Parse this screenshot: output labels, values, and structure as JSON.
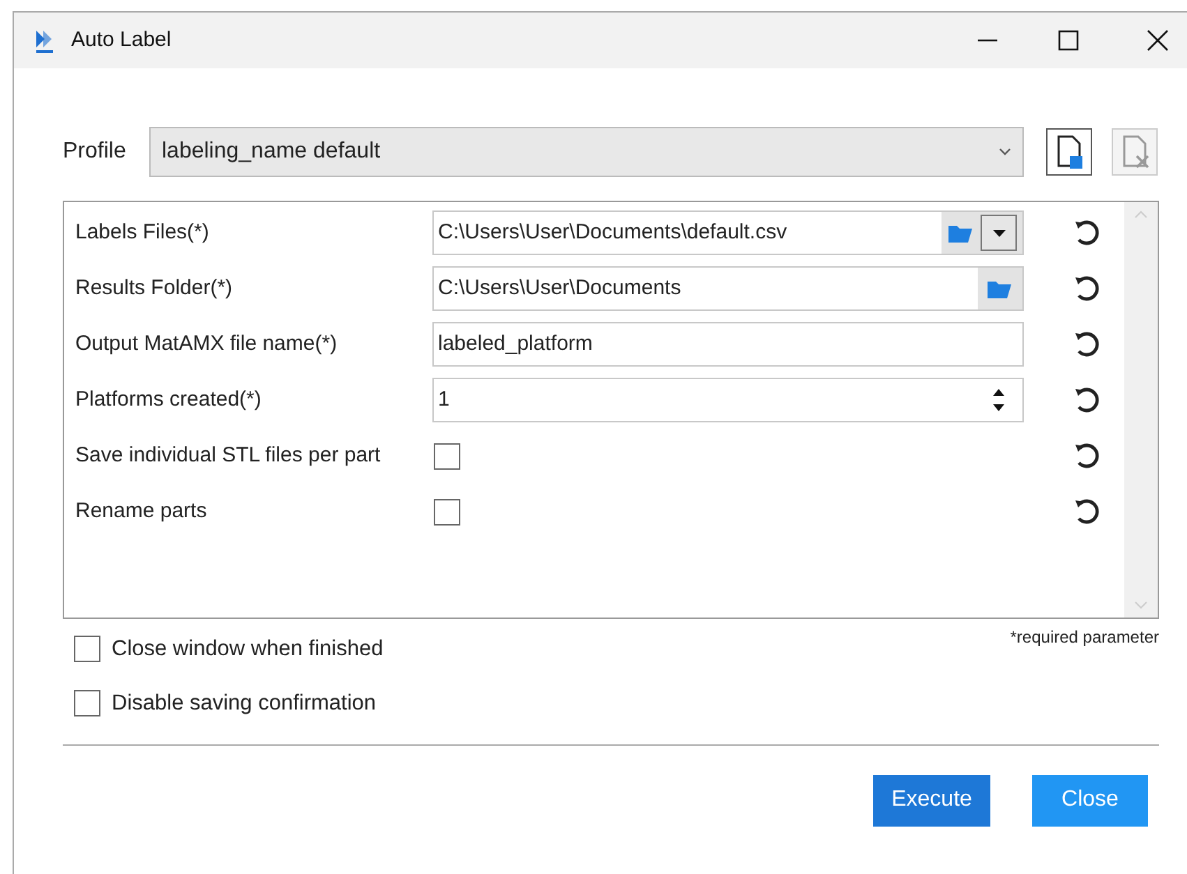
{
  "window": {
    "title": "Auto Label"
  },
  "profile": {
    "label": "Profile",
    "value": "labeling_name default"
  },
  "parameters": [
    {
      "kind": "file",
      "label": "Labels Files(*)",
      "value": "C:\\Users\\User\\Documents\\default.csv"
    },
    {
      "kind": "folder",
      "label": "Results Folder(*)",
      "value": "C:\\Users\\User\\Documents"
    },
    {
      "kind": "text",
      "label": "Output MatAMX file name(*)",
      "value": "labeled_platform"
    },
    {
      "kind": "spinner",
      "label": "Platforms created(*)",
      "value": "1"
    },
    {
      "kind": "checkbox",
      "label": "Save individual STL files per part",
      "checked": false
    },
    {
      "kind": "checkbox",
      "label": "Rename parts",
      "checked": false
    }
  ],
  "required_note": "*required parameter",
  "options": [
    {
      "label": "Close window when finished",
      "checked": false
    },
    {
      "label": "Disable saving confirmation",
      "checked": false
    }
  ],
  "buttons": [
    {
      "label": "Execute",
      "primary": true
    },
    {
      "label": "Close",
      "primary": false
    }
  ]
}
